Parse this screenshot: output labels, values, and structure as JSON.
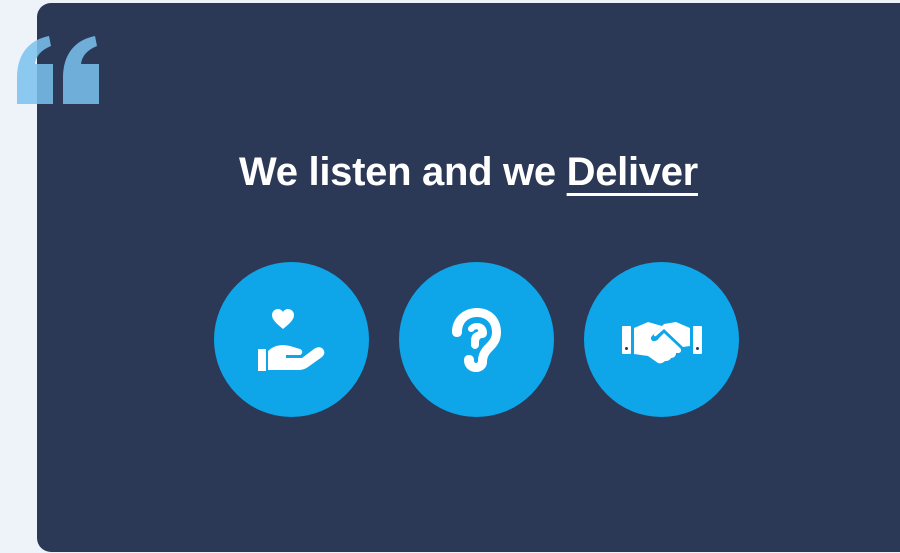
{
  "headline": {
    "prefix": "We listen and we ",
    "emphasis": "Deliver"
  },
  "icons": [
    {
      "name": "hand-heart-icon"
    },
    {
      "name": "ear-icon"
    },
    {
      "name": "handshake-icon"
    }
  ],
  "colors": {
    "background": "#eef2f9",
    "card": "#2b3856",
    "accent": "#0ea5e9",
    "quote_mark": "#7cc3ef"
  }
}
